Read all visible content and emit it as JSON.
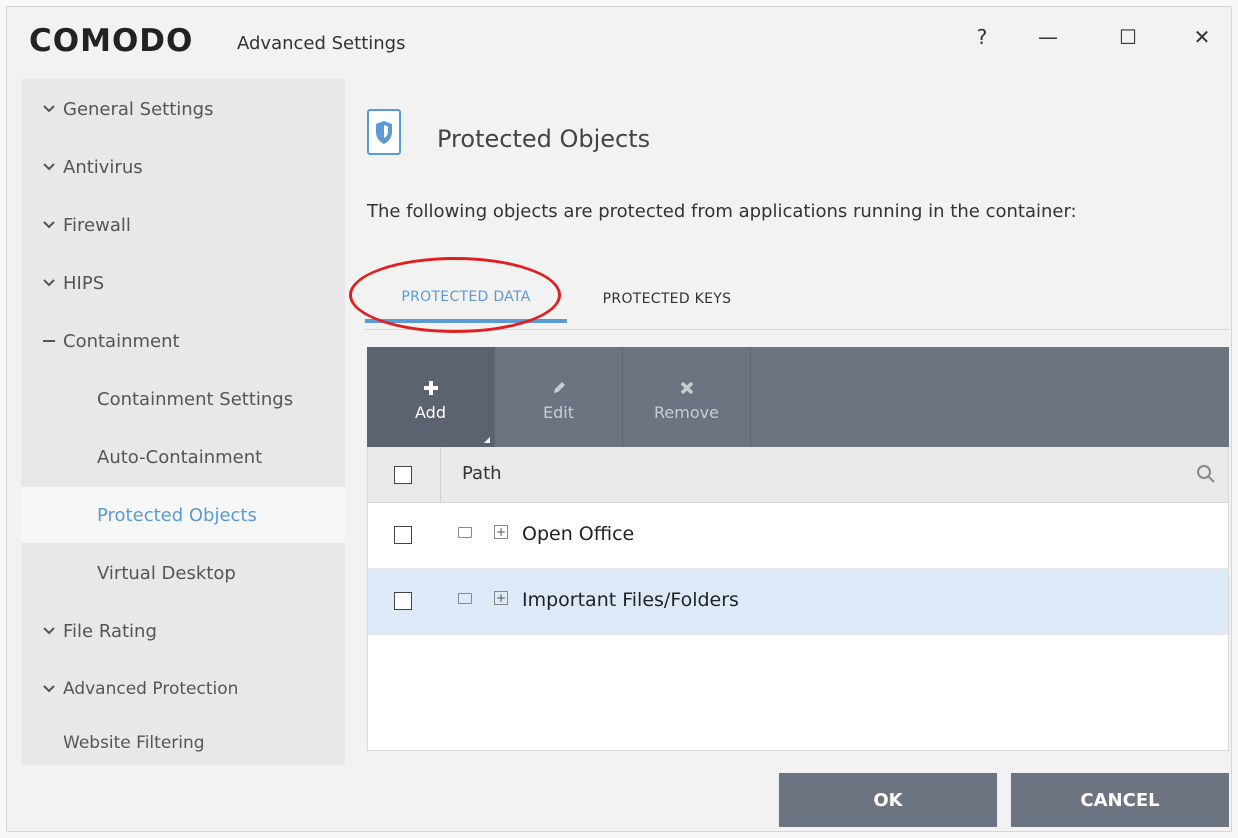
{
  "titlebar": {
    "logo": "COMODO",
    "title": "Advanced Settings",
    "help": "?",
    "minimize": "—",
    "maximize": "☐",
    "close": "✕"
  },
  "sidebar": {
    "items": [
      {
        "label": "General Settings",
        "icon": "chevron-down-icon"
      },
      {
        "label": "Antivirus",
        "icon": "chevron-down-icon"
      },
      {
        "label": "Firewall",
        "icon": "chevron-down-icon"
      },
      {
        "label": "HIPS",
        "icon": "chevron-down-icon"
      },
      {
        "label": "Containment",
        "icon": "minus-icon"
      },
      {
        "label": "Containment Settings"
      },
      {
        "label": "Auto-Containment"
      },
      {
        "label": "Protected Objects",
        "active": true
      },
      {
        "label": "Virtual Desktop"
      },
      {
        "label": "File Rating",
        "icon": "chevron-down-icon"
      },
      {
        "label": "Advanced Protection",
        "icon": "chevron-down-icon"
      },
      {
        "label": "Website Filtering"
      }
    ]
  },
  "main": {
    "title": "Protected Objects",
    "description": "The following objects are protected from applications running in the container:",
    "tabs": [
      {
        "label": "PROTECTED DATA",
        "active": true
      },
      {
        "label": "PROTECTED KEYS",
        "active": false
      }
    ],
    "toolbar": {
      "add": "Add",
      "edit": "Edit",
      "remove": "Remove"
    },
    "table": {
      "column": "Path",
      "rows": [
        {
          "label": "Open Office",
          "selected": false
        },
        {
          "label": "Important Files/Folders",
          "selected": true
        }
      ]
    }
  },
  "footer": {
    "ok": "OK",
    "cancel": "CANCEL"
  },
  "colors": {
    "accent": "#5a9bd5",
    "toolbar": "#6c7482",
    "highlight_circle": "#e02020"
  }
}
